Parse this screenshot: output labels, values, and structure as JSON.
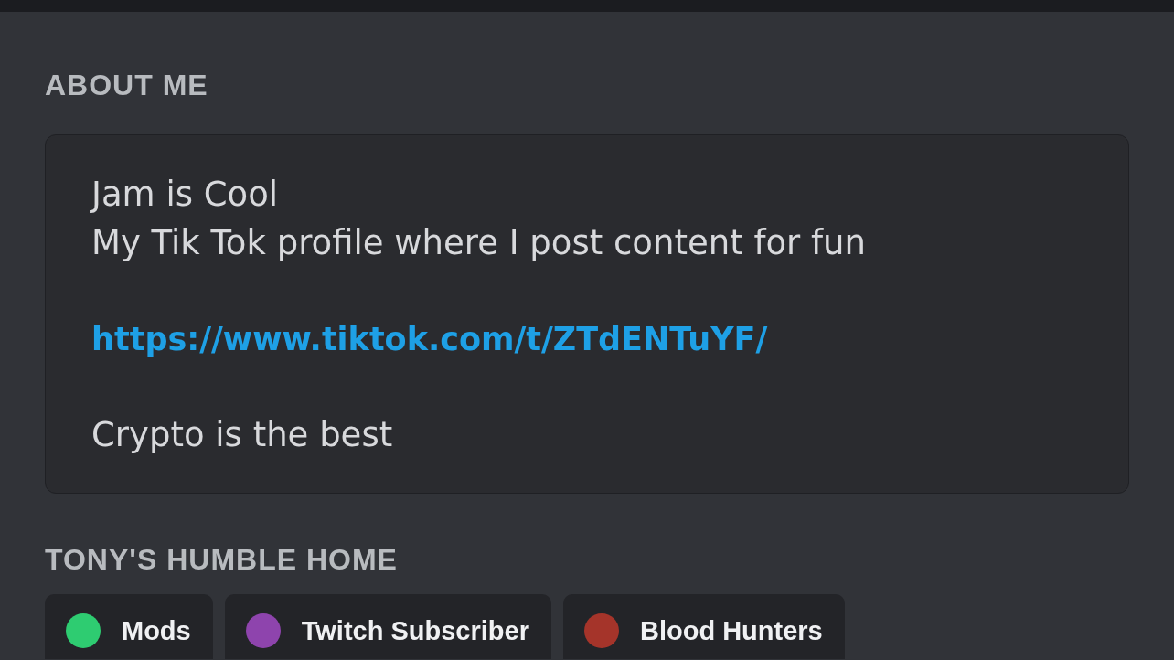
{
  "about_me": {
    "heading": "ABOUT ME",
    "paragraphs": [
      {
        "kind": "text",
        "lines": [
          "Jam is Cool",
          "My Tik Tok profile where I post content for fun"
        ]
      },
      {
        "kind": "link",
        "lines": [
          "https://www.tiktok.com/t/ZTdENTuYF/"
        ]
      },
      {
        "kind": "text",
        "lines": [
          "Crypto is the best"
        ]
      }
    ]
  },
  "roles": {
    "heading": "TONY'S HUMBLE HOME",
    "items": [
      {
        "name": "Mods",
        "color": "#2ecc71"
      },
      {
        "name": "Twitch Subscriber",
        "color": "#8e44ad"
      },
      {
        "name": "Blood Hunters",
        "color": "#a5342a"
      }
    ]
  }
}
